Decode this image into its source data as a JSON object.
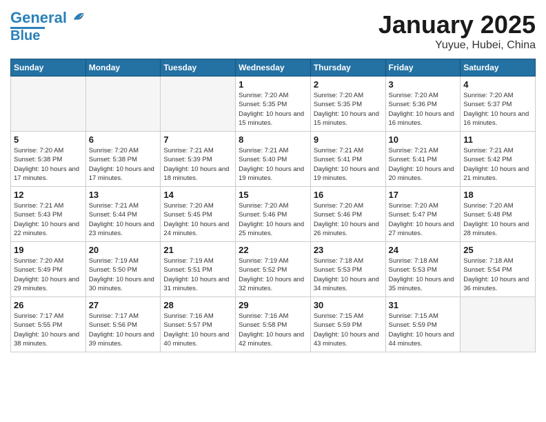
{
  "logo": {
    "line1": "General",
    "line2": "Blue"
  },
  "title": "January 2025",
  "subtitle": "Yuyue, Hubei, China",
  "days_of_week": [
    "Sunday",
    "Monday",
    "Tuesday",
    "Wednesday",
    "Thursday",
    "Friday",
    "Saturday"
  ],
  "weeks": [
    [
      {
        "day": "",
        "info": ""
      },
      {
        "day": "",
        "info": ""
      },
      {
        "day": "",
        "info": ""
      },
      {
        "day": "1",
        "info": "Sunrise: 7:20 AM\nSunset: 5:35 PM\nDaylight: 10 hours and 15 minutes."
      },
      {
        "day": "2",
        "info": "Sunrise: 7:20 AM\nSunset: 5:35 PM\nDaylight: 10 hours and 15 minutes."
      },
      {
        "day": "3",
        "info": "Sunrise: 7:20 AM\nSunset: 5:36 PM\nDaylight: 10 hours and 16 minutes."
      },
      {
        "day": "4",
        "info": "Sunrise: 7:20 AM\nSunset: 5:37 PM\nDaylight: 10 hours and 16 minutes."
      }
    ],
    [
      {
        "day": "5",
        "info": "Sunrise: 7:20 AM\nSunset: 5:38 PM\nDaylight: 10 hours and 17 minutes."
      },
      {
        "day": "6",
        "info": "Sunrise: 7:20 AM\nSunset: 5:38 PM\nDaylight: 10 hours and 17 minutes."
      },
      {
        "day": "7",
        "info": "Sunrise: 7:21 AM\nSunset: 5:39 PM\nDaylight: 10 hours and 18 minutes."
      },
      {
        "day": "8",
        "info": "Sunrise: 7:21 AM\nSunset: 5:40 PM\nDaylight: 10 hours and 19 minutes."
      },
      {
        "day": "9",
        "info": "Sunrise: 7:21 AM\nSunset: 5:41 PM\nDaylight: 10 hours and 19 minutes."
      },
      {
        "day": "10",
        "info": "Sunrise: 7:21 AM\nSunset: 5:41 PM\nDaylight: 10 hours and 20 minutes."
      },
      {
        "day": "11",
        "info": "Sunrise: 7:21 AM\nSunset: 5:42 PM\nDaylight: 10 hours and 21 minutes."
      }
    ],
    [
      {
        "day": "12",
        "info": "Sunrise: 7:21 AM\nSunset: 5:43 PM\nDaylight: 10 hours and 22 minutes."
      },
      {
        "day": "13",
        "info": "Sunrise: 7:21 AM\nSunset: 5:44 PM\nDaylight: 10 hours and 23 minutes."
      },
      {
        "day": "14",
        "info": "Sunrise: 7:20 AM\nSunset: 5:45 PM\nDaylight: 10 hours and 24 minutes."
      },
      {
        "day": "15",
        "info": "Sunrise: 7:20 AM\nSunset: 5:46 PM\nDaylight: 10 hours and 25 minutes."
      },
      {
        "day": "16",
        "info": "Sunrise: 7:20 AM\nSunset: 5:46 PM\nDaylight: 10 hours and 26 minutes."
      },
      {
        "day": "17",
        "info": "Sunrise: 7:20 AM\nSunset: 5:47 PM\nDaylight: 10 hours and 27 minutes."
      },
      {
        "day": "18",
        "info": "Sunrise: 7:20 AM\nSunset: 5:48 PM\nDaylight: 10 hours and 28 minutes."
      }
    ],
    [
      {
        "day": "19",
        "info": "Sunrise: 7:20 AM\nSunset: 5:49 PM\nDaylight: 10 hours and 29 minutes."
      },
      {
        "day": "20",
        "info": "Sunrise: 7:19 AM\nSunset: 5:50 PM\nDaylight: 10 hours and 30 minutes."
      },
      {
        "day": "21",
        "info": "Sunrise: 7:19 AM\nSunset: 5:51 PM\nDaylight: 10 hours and 31 minutes."
      },
      {
        "day": "22",
        "info": "Sunrise: 7:19 AM\nSunset: 5:52 PM\nDaylight: 10 hours and 32 minutes."
      },
      {
        "day": "23",
        "info": "Sunrise: 7:18 AM\nSunset: 5:53 PM\nDaylight: 10 hours and 34 minutes."
      },
      {
        "day": "24",
        "info": "Sunrise: 7:18 AM\nSunset: 5:53 PM\nDaylight: 10 hours and 35 minutes."
      },
      {
        "day": "25",
        "info": "Sunrise: 7:18 AM\nSunset: 5:54 PM\nDaylight: 10 hours and 36 minutes."
      }
    ],
    [
      {
        "day": "26",
        "info": "Sunrise: 7:17 AM\nSunset: 5:55 PM\nDaylight: 10 hours and 38 minutes."
      },
      {
        "day": "27",
        "info": "Sunrise: 7:17 AM\nSunset: 5:56 PM\nDaylight: 10 hours and 39 minutes."
      },
      {
        "day": "28",
        "info": "Sunrise: 7:16 AM\nSunset: 5:57 PM\nDaylight: 10 hours and 40 minutes."
      },
      {
        "day": "29",
        "info": "Sunrise: 7:16 AM\nSunset: 5:58 PM\nDaylight: 10 hours and 42 minutes."
      },
      {
        "day": "30",
        "info": "Sunrise: 7:15 AM\nSunset: 5:59 PM\nDaylight: 10 hours and 43 minutes."
      },
      {
        "day": "31",
        "info": "Sunrise: 7:15 AM\nSunset: 5:59 PM\nDaylight: 10 hours and 44 minutes."
      },
      {
        "day": "",
        "info": ""
      }
    ]
  ]
}
